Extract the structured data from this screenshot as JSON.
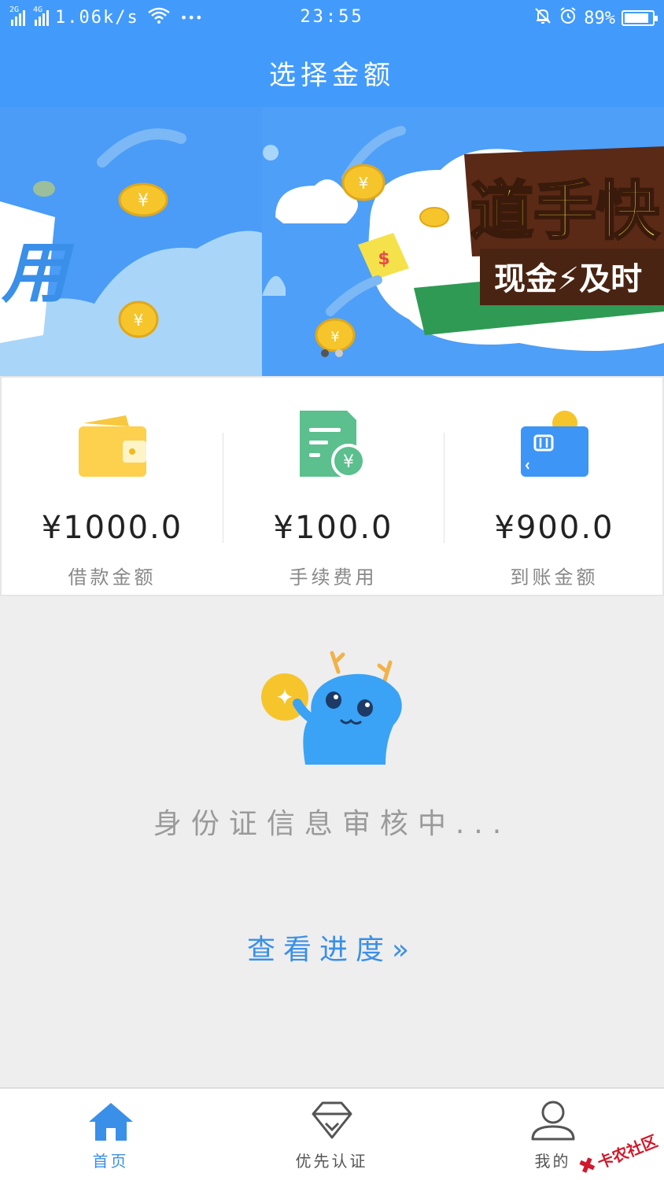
{
  "status_bar": {
    "sim1_type": "2G",
    "sim2_type": "4G",
    "network_speed": "1.06k/s",
    "more": "•••",
    "time": "23:55",
    "battery_percent": "89%",
    "battery_level": 0.89,
    "icons": [
      "signal-icon",
      "wifi-icon",
      "mute-bell-icon",
      "alarm-icon",
      "battery-icon"
    ]
  },
  "header": {
    "title": "选择金额"
  },
  "banner": {
    "slide_left_text": "用",
    "slide_right_title": "道手快",
    "slide_right_subtitle": "现金⚡及时",
    "coin_symbol": "¥",
    "dollar_symbol": "$",
    "indicator_count": 2,
    "indicator_active": 0
  },
  "amounts": [
    {
      "value": "¥1000.0",
      "label": "借款金额",
      "icon": "wallet-icon"
    },
    {
      "value": "¥100.0",
      "label": "手续费用",
      "icon": "fee-document-icon"
    },
    {
      "value": "¥900.0",
      "label": "到账金额",
      "icon": "bank-card-icon"
    }
  ],
  "review": {
    "status_text": "身份证信息审核中...",
    "link_text": "查看进度»",
    "coin_symbol": "✦"
  },
  "tabbar": {
    "tabs": [
      {
        "label": "首页",
        "icon": "home-icon",
        "active": true
      },
      {
        "label": "优先认证",
        "icon": "diamond-icon",
        "active": false
      },
      {
        "label": "我的",
        "icon": "user-icon",
        "active": false
      }
    ]
  },
  "watermark": {
    "text": "卡农社区"
  },
  "colors": {
    "primary": "#429bfb",
    "link": "#3a8fe8",
    "wallet": "#fdd04d",
    "fee_doc": "#5bbf8e",
    "card": "#3d95f5",
    "coin": "#f6c52b",
    "mascot": "#3aa3f5",
    "background": "#eeeeee",
    "watermark": "#d0192b"
  }
}
